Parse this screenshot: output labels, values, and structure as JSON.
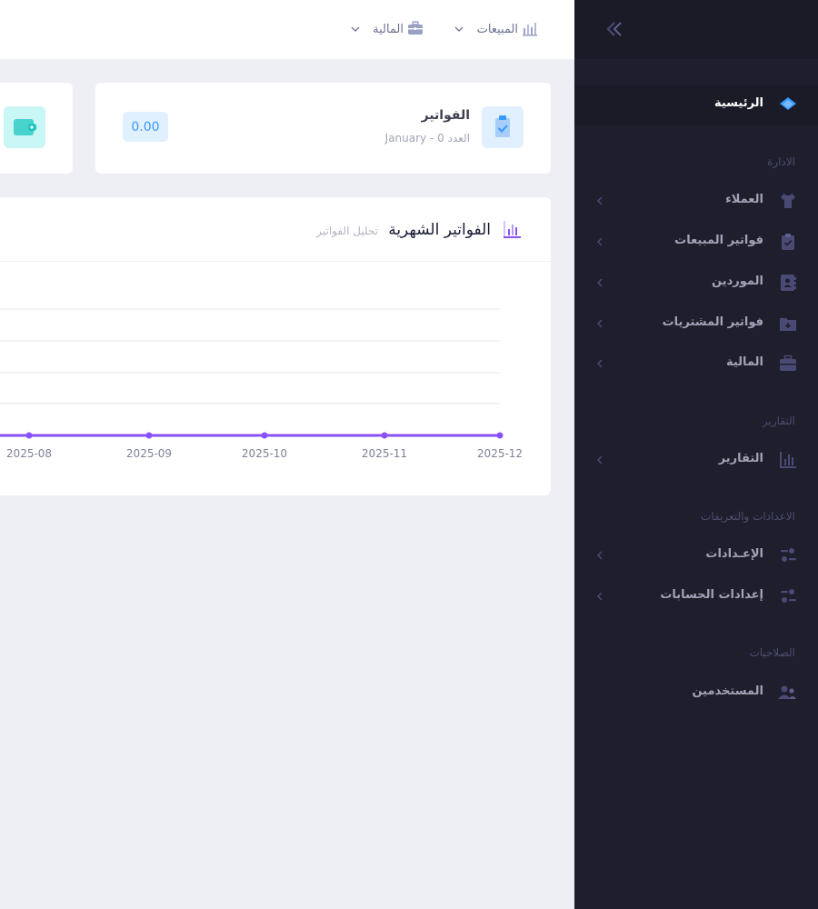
{
  "topbar": {
    "menus": [
      {
        "label": "المبيعات",
        "icon": "bar-chart-icon"
      },
      {
        "label": "المالية",
        "icon": "briefcase-icon"
      }
    ]
  },
  "sidebar": {
    "home": {
      "label": "الرئيسية",
      "icon": "layers-icon"
    },
    "sections": [
      {
        "title": "الادارة"
      },
      {
        "title": "التقارير"
      },
      {
        "title": "الاعدادات والتعريفات"
      },
      {
        "title": "الصلاحيات"
      }
    ],
    "items": [
      {
        "label": "العملاء",
        "icon": "shirt-icon"
      },
      {
        "label": "فواتير المبيعات",
        "icon": "clipboard-check-icon"
      },
      {
        "label": "الموردين",
        "icon": "address-book-icon"
      },
      {
        "label": "فواتير المشتريات",
        "icon": "folder-download-icon"
      },
      {
        "label": "المالية",
        "icon": "briefcase-icon"
      },
      {
        "label": "التقارير",
        "icon": "bar-chart-icon"
      },
      {
        "label": "الإعـدادات",
        "icon": "settings-dots-icon"
      },
      {
        "label": "إعدادات الحسابات",
        "icon": "settings-dots-icon"
      },
      {
        "label": "المستخدمين",
        "icon": "users-icon"
      }
    ]
  },
  "stats": {
    "invoices": {
      "title": "الفواتير",
      "subtitle": "January - العدد 0",
      "value": "0.00",
      "icon": "clipboard-check-icon"
    },
    "second_icon": "wallet-icon"
  },
  "chart_card": {
    "title": "الفواتير الشهرية",
    "subtitle": "تحليل الفواتير",
    "icon": "bar-chart-icon"
  },
  "chart_data": {
    "type": "line",
    "x": [
      "2025-08",
      "2025-09",
      "2025-10",
      "2025-11",
      "2025-12"
    ],
    "series": [
      {
        "values": [
          0,
          0,
          0,
          0,
          0
        ]
      }
    ],
    "grid": true,
    "colors": {
      "line": "#8950fc",
      "grid": "#e4e6ef",
      "tick": "#7e8299"
    }
  },
  "colors": {
    "sidebar_bg": "#1e1e2d",
    "accent_blue": "#3699ff",
    "accent_purple": "#8950fc",
    "accent_teal": "#1bc5bd"
  }
}
